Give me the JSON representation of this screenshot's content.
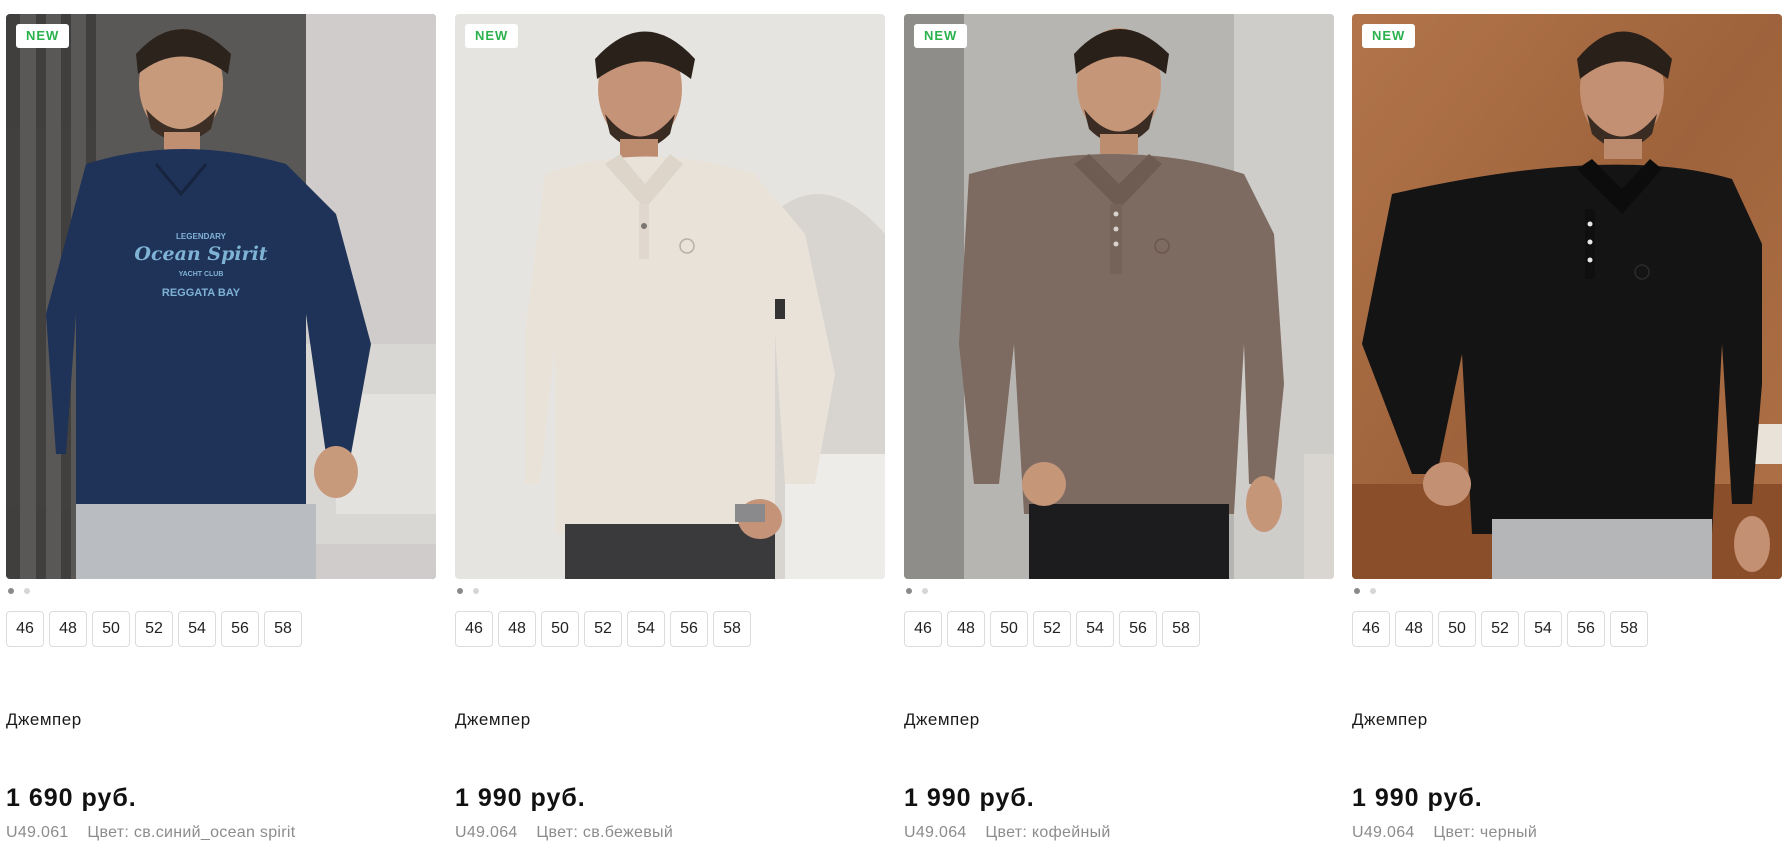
{
  "products": [
    {
      "badge": "NEW",
      "name": "Джемпер",
      "price": "1 690 руб.",
      "sku": "U49.061",
      "color_label": "Цвет:",
      "color": "св.синий_ocean spirit",
      "sizes": [
        "46",
        "48",
        "50",
        "52",
        "54",
        "56",
        "58"
      ],
      "image_colors": {
        "bg": "#5c5a58",
        "garment": "#1f3257",
        "pants": "#b9bcc0"
      },
      "print_lines": [
        "LEGENDARY",
        "Ocean Spirit",
        "YACHT CLUB",
        "REGGATA BAY"
      ]
    },
    {
      "badge": "NEW",
      "name": "Джемпер",
      "price": "1 990 руб.",
      "sku": "U49.064",
      "color_label": "Цвет:",
      "color": "св.бежевый",
      "sizes": [
        "46",
        "48",
        "50",
        "52",
        "54",
        "56",
        "58"
      ],
      "image_colors": {
        "bg": "#e4e2df",
        "garment": "#e7e0d8",
        "pants": "#3a3a3c"
      }
    },
    {
      "badge": "NEW",
      "name": "Джемпер",
      "price": "1 990 руб.",
      "sku": "U49.064",
      "color_label": "Цвет:",
      "color": "кофейный",
      "sizes": [
        "46",
        "48",
        "50",
        "52",
        "54",
        "56",
        "58"
      ],
      "image_colors": {
        "bg": "#b8b6b2",
        "garment": "#7d6a60",
        "pants": "#1c1c1e"
      }
    },
    {
      "badge": "NEW",
      "name": "Джемпер",
      "price": "1 990 руб.",
      "sku": "U49.064",
      "color_label": "Цвет:",
      "color": "черный",
      "sizes": [
        "46",
        "48",
        "50",
        "52",
        "54",
        "56",
        "58"
      ],
      "image_colors": {
        "bg": "#a9683f",
        "garment": "#141414",
        "pants": "#b4b6b8"
      }
    }
  ],
  "accent_colors": {
    "badge_text": "#2bb24c",
    "meta_text": "#8c8c8c"
  }
}
